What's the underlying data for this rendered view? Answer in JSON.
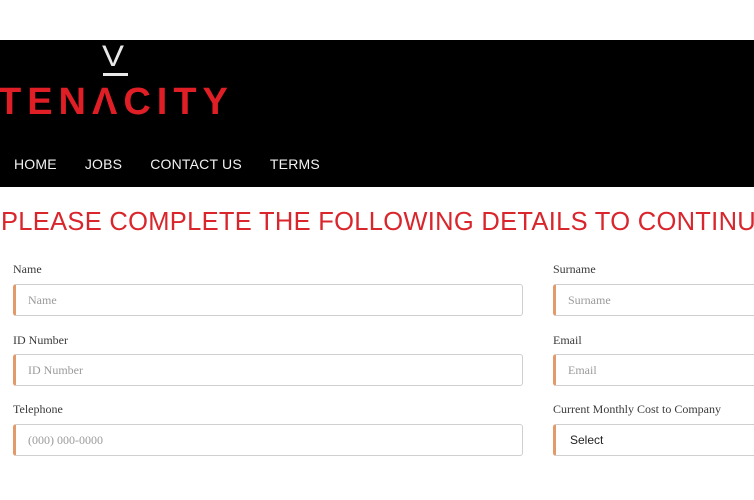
{
  "brand": {
    "logo_top": "V",
    "logo_word": "TENΛCITY",
    "colors": {
      "header_bg": "#000000",
      "accent_red": "#e01e26",
      "input_accent": "#e39a6b"
    }
  },
  "nav": {
    "items": [
      {
        "label": "HOME"
      },
      {
        "label": "JOBS"
      },
      {
        "label": "CONTACT US"
      },
      {
        "label": "TERMS"
      }
    ]
  },
  "form": {
    "title": "PLEASE COMPLETE THE FOLLOWING DETAILS TO CONTINUE",
    "name": {
      "label": "Name",
      "placeholder": "Name"
    },
    "surname": {
      "label": "Surname",
      "placeholder": "Surname"
    },
    "id_number": {
      "label": "ID Number",
      "placeholder": "ID Number"
    },
    "email": {
      "label": "Email",
      "placeholder": "Email"
    },
    "telephone": {
      "label": "Telephone",
      "placeholder": "(000) 000-0000"
    },
    "monthly_cost": {
      "label": "Current Monthly Cost to Company",
      "selected": "Select"
    }
  }
}
